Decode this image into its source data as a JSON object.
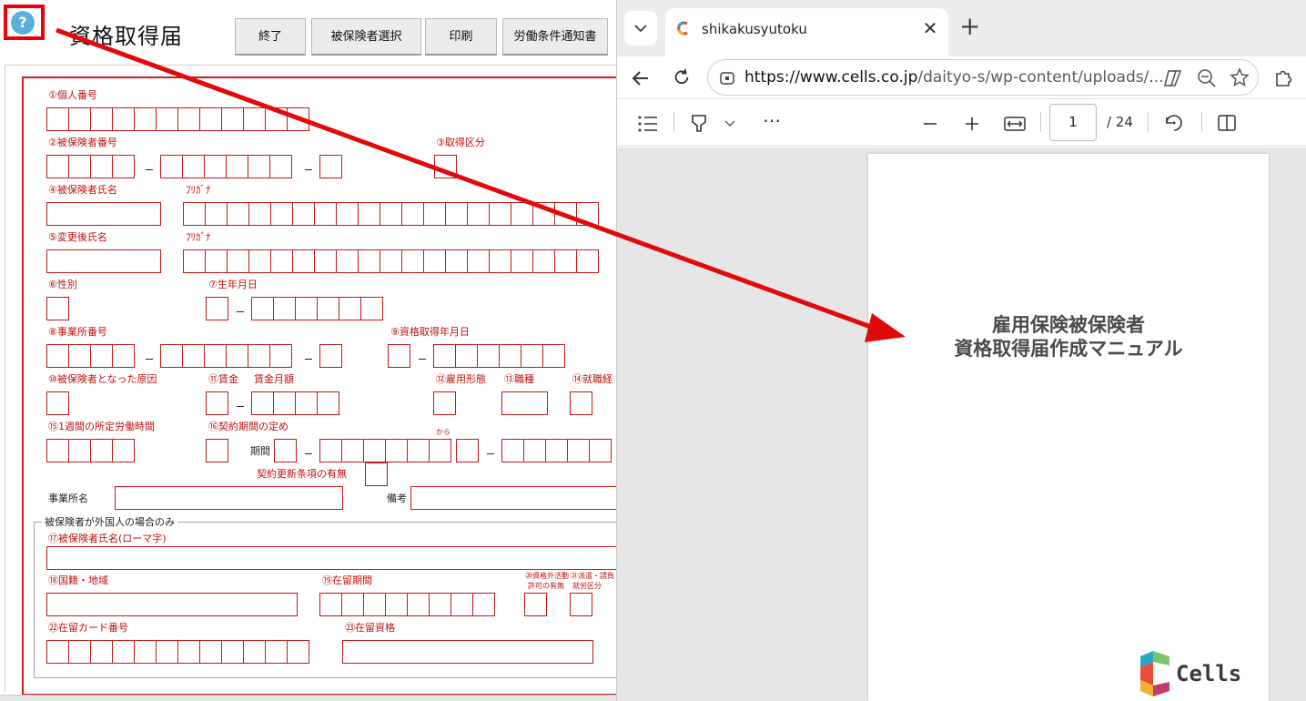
{
  "form": {
    "help_icon": "?",
    "title": "資格取得届",
    "buttons": {
      "exit": "終了",
      "select": "被保険者選択",
      "print": "印刷",
      "notice": "労働条件通知書"
    },
    "labels": {
      "l1": "①個人番号",
      "l2": "②被保険者番号",
      "l3": "③取得区分",
      "l4": "④被保険者氏名",
      "furigana1": "ﾌﾘｶﾞﾅ",
      "l5": "⑤変更後氏名",
      "furigana2": "ﾌﾘｶﾞﾅ",
      "l6": "⑥性別",
      "l7": "⑦生年月日",
      "l8": "⑧事業所番号",
      "l9": "⑨資格取得年月日",
      "l10": "⑩被保険者となった原因",
      "l11": "⑪賃金",
      "l11b": "賃金月額",
      "l12": "⑫雇用形態",
      "l13": "⑬職種",
      "l14": "⑭就職経",
      "l15": "⑮1週間の所定労働時間",
      "l16": "⑯契約期間の定め",
      "kara": "から",
      "kikan": "期間",
      "renewal": "契約更新条項の有無",
      "office_name": "事業所名",
      "remarks": "備考",
      "foreign_group": "被保険者が外国人の場合のみ",
      "l17": "⑰被保険者氏名(ローマ字)",
      "l18": "⑱国籍・地域",
      "l19": "⑲在留期間",
      "l20a": "⑳資格外活動",
      "l20b": "許可の有無",
      "l21a": "㉑派遣・請負",
      "l21b": "就労区分",
      "l22": "㉒在留カード番号",
      "l23": "㉓在留資格"
    }
  },
  "browser": {
    "tab_title": "shikakusyutoku",
    "close_glyph": "✕",
    "new_tab_glyph": "+",
    "url_host": "https://www.cells.co.jp",
    "url_path": "/daityo-s/wp-content/uploads/...",
    "page_current": "1",
    "page_total": "/ 24",
    "doc_title_line1": "雇用保険被保険者",
    "doc_title_line2": "資格取得届作成マニュアル",
    "logo_text": "Cells"
  },
  "colors": {
    "annotation_red": "#e8000d",
    "form_red": "#c41818",
    "help_blue": "#5ab0db"
  }
}
